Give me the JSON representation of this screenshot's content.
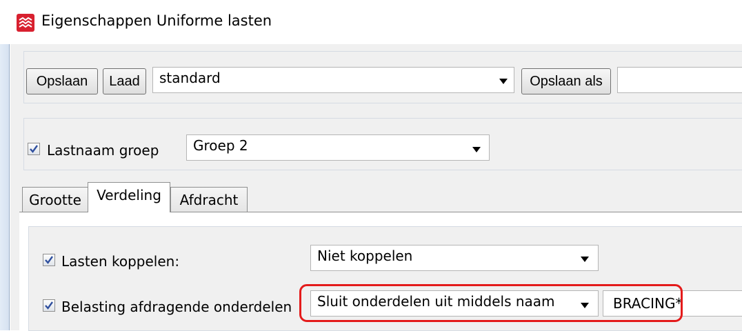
{
  "window": {
    "title": "Eigenschappen Uniforme lasten"
  },
  "toolbar": {
    "save_label": "Opslaan",
    "load_label": "Laad",
    "preset_value": "standard",
    "save_as_label": "Opslaan als",
    "save_as_name": ""
  },
  "load_group": {
    "checked": true,
    "label": "Lastnaam groep",
    "value": "Groep 2"
  },
  "tabs": [
    {
      "label": "Grootte",
      "active": false
    },
    {
      "label": "Verdeling",
      "active": true
    },
    {
      "label": "Afdracht",
      "active": false
    }
  ],
  "distribution": {
    "couple_loads": {
      "checked": true,
      "label": "Lasten koppelen:",
      "value": "Niet koppelen"
    },
    "load_bearing_parts": {
      "checked": true,
      "label": "Belasting afdragende onderdelen",
      "mode_value": "Sluit onderdelen uit middels naam",
      "name_filter": "BRACING*"
    }
  },
  "colors": {
    "highlight": "#e41b1b",
    "dialog_background": "#f0f0f0",
    "checkmark": "#2f4f9e"
  }
}
